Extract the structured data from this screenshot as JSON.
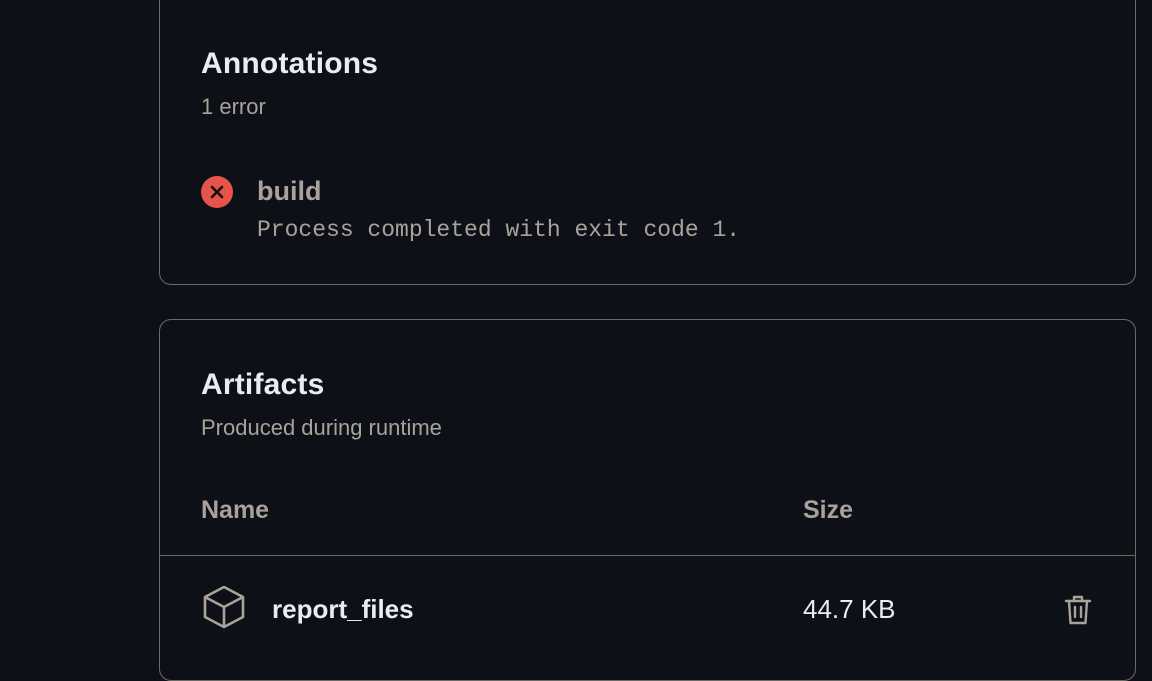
{
  "annotations": {
    "title": "Annotations",
    "subtitle": "1 error",
    "items": [
      {
        "severity": "error",
        "icon": "x-circle-fill-icon",
        "title": "build",
        "message": "Process completed with exit code 1."
      }
    ]
  },
  "artifacts": {
    "title": "Artifacts",
    "subtitle": "Produced during runtime",
    "columns": {
      "name": "Name",
      "size": "Size"
    },
    "rows": [
      {
        "icon": "package-icon",
        "name": "report_files",
        "size": "44.7 KB",
        "action_icon": "trash-icon"
      }
    ]
  },
  "colors": {
    "background": "#0d1117",
    "border": "#6e6a63",
    "text_primary": "#e6edf3",
    "text_muted": "#a8a29a",
    "error": "#e5534b"
  }
}
